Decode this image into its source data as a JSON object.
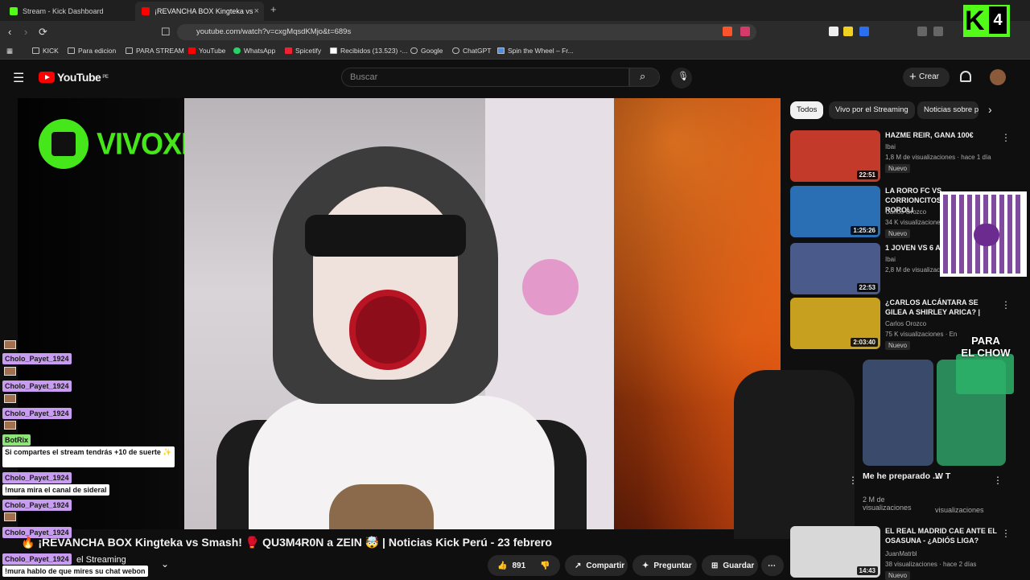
{
  "browser": {
    "tabs": [
      {
        "label": "Stream - Kick Dashboard",
        "color": "#53fc18"
      },
      {
        "label": "¡REVANCHA BOX Kingteka vs",
        "color": "#ff0000"
      }
    ],
    "url": "youtube.com/watch?v=cxgMqsdKMjo&t=689s",
    "bookmarks": [
      "KICK",
      "Para edicion",
      "PARA STREAM",
      "YouTube",
      "WhatsApp",
      "Spicetify",
      "Recibidos (13.523) -...",
      "Google",
      "ChatGPT",
      "Spin the Wheel – Fr..."
    ]
  },
  "youtube": {
    "logo_text": "YouTube",
    "region": "PE",
    "search_placeholder": "Buscar",
    "create_label": "Crear"
  },
  "player": {
    "brand_text": "VIVOXELSTREAMING"
  },
  "video": {
    "title": "🔥 ¡REVANCHA BOX Kingteka vs Smash! 🥊 QU3M4R0N a ZEIN 🤯 | Noticias Kick Perú - 23 febrero",
    "channel_suffix": "el Streaming",
    "like_count": "891",
    "share_label": "Compartir",
    "ask_label": "Preguntar",
    "save_label": "Guardar"
  },
  "chat": {
    "messages": [
      {
        "user": "Cholo_Payet_1924",
        "text": ""
      },
      {
        "user": "Cholo_Payet_1924",
        "text": ""
      },
      {
        "user": "Cholo_Payet_1924",
        "text": ""
      },
      {
        "user": "BotRix",
        "text": "Si compartes el stream tendrás +10 de suerte ✨"
      },
      {
        "user": "Cholo_Payet_1924",
        "text": "!mura mira el canal de sideral"
      },
      {
        "user": "Cholo_Payet_1924",
        "text": ""
      },
      {
        "user": "Cholo_Payet_1924",
        "text": ""
      },
      {
        "user": "Cholo_Payet_1924",
        "text": "!mura hablo de que mires su chat webon"
      }
    ]
  },
  "chips": [
    "Todos",
    "Vivo por el Streaming",
    "Noticias sobre p"
  ],
  "recommendations": [
    {
      "title": "HAZME REIR, GANA 100€",
      "channel": "Ibai",
      "meta": "1,8 M de visualizaciones · hace 1 día",
      "badge": "Nuevo",
      "duration": "22:51",
      "thumb_color": "#c43a2a"
    },
    {
      "title": "LA RORO FC VS CORRIONCITOS FC ⚽ | ROROLI",
      "channel": "Carlos Orozco",
      "meta": "34 K visualizaciones",
      "badge": "Nuevo",
      "duration": "1:25:26",
      "thumb_color": "#2a6fb3"
    },
    {
      "title": "1 JOVEN VS 6 A",
      "channel": "Ibai",
      "meta": "2,8 M de visualizaciones",
      "badge": "",
      "duration": "22:53",
      "thumb_color": "#4a5a8a"
    },
    {
      "title": "¿CARLOS ALCÁNTARA SE GILEA A SHIRLEY ARICA? |",
      "channel": "Carlos Orozco",
      "meta": "75 K visualizaciones · En",
      "badge": "Nuevo",
      "duration": "2:03:40",
      "thumb_color": "#c8a020"
    }
  ],
  "shorts": [
    {
      "title": "Me he preparado ...",
      "meta": "2 M de visualizaciones",
      "thumb_color": "#3a4a6a"
    },
    {
      "title": "W T",
      "meta": "visualizaciones",
      "thumb_color": "#2a8a5a"
    }
  ],
  "bottom_rec": {
    "title": "EL REAL MADRID CAE ANTE EL OSASUNA - ¿ADIÓS LIGA?",
    "channel": "JuanMatrbl",
    "meta": "38 visualizaciones · hace 2 días",
    "badge": "Nuevo",
    "duration": "14:43"
  },
  "overlay": {
    "kick_badge_letter": "K",
    "kick_badge_number": "4",
    "para_text_1": "PARA",
    "para_text_2": "EL CHOW"
  }
}
